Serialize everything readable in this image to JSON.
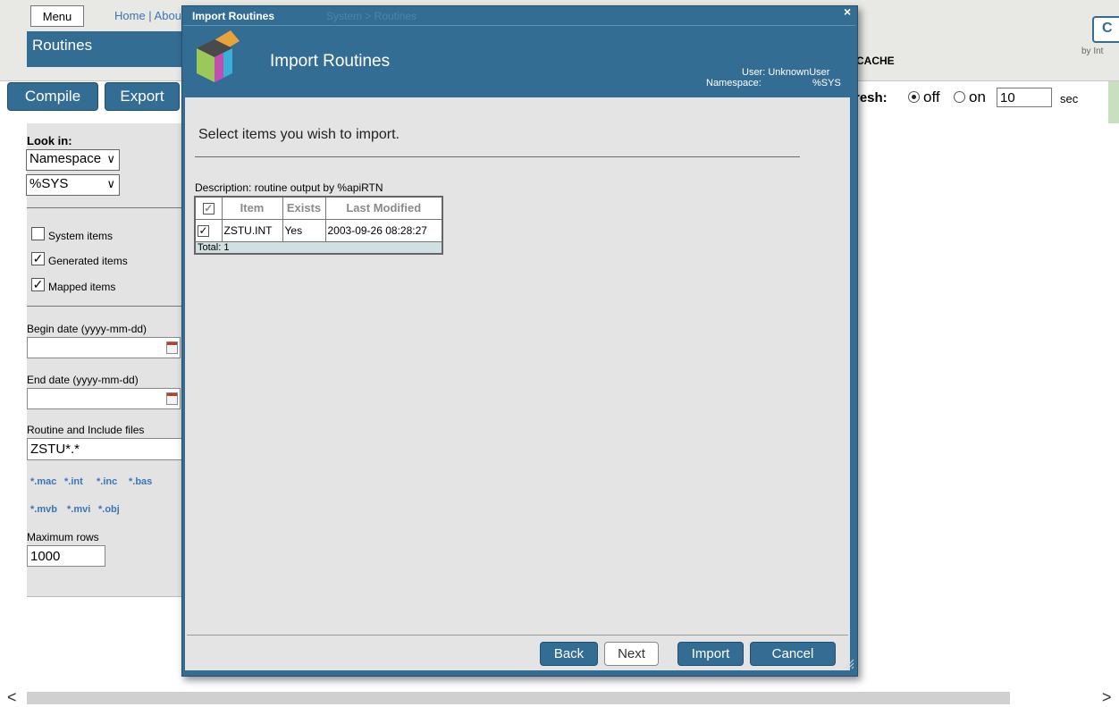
{
  "background": {
    "menu_label": "Menu",
    "top_links": "Home | About",
    "page_title": "Routines",
    "cache_text": "CACHE",
    "c_button": "C",
    "by_text": "by Int",
    "toolbar": {
      "compile": "Compile",
      "export": "Export"
    },
    "refresh": {
      "label": "resh:",
      "off": "off",
      "on": "on",
      "value": "10",
      "unit": "sec"
    },
    "left_panel": {
      "look_in_label": "Look in:",
      "look_in_value": "Namespace",
      "namespace_value": "%SYS",
      "system_items": "System items",
      "generated_items": "Generated items",
      "mapped_items": "Mapped items",
      "begin_date_label": "Begin date (yyyy-mm-dd)",
      "end_date_label": "End date (yyyy-mm-dd)",
      "routine_label": "Routine and Include files",
      "routine_value": "ZSTU*.*",
      "extensions": [
        "*.mac",
        "*.int",
        "*.inc",
        "*.bas",
        "*.mvb",
        "*.mvi",
        "*.obj"
      ],
      "max_rows_label": "Maximum rows",
      "max_rows_value": "1000"
    },
    "scroll": {
      "left": "<",
      "right": ">"
    }
  },
  "dialog": {
    "titlebar": "Import Routines",
    "titlebar_ghost": "System > Routines",
    "close": "×",
    "heading": "Import Routines",
    "user": "User: UnknownUser",
    "namespace_label": "Namespace:",
    "namespace_value": "%SYS",
    "instruction": "Select items you wish to import.",
    "description": "Description: routine output by %apiRTN",
    "table": {
      "headers": {
        "item": "Item",
        "exists": "Exists",
        "modified": "Last Modified"
      },
      "rows": [
        {
          "item": "ZSTU.INT",
          "exists": "Yes",
          "modified": "2003-09-26 08:28:27"
        }
      ],
      "total": "Total: 1"
    },
    "buttons": {
      "back": "Back",
      "next": "Next",
      "import": "Import",
      "cancel": "Cancel"
    }
  },
  "colors": {
    "accent": "#346d94",
    "panel": "#e4e4e4",
    "link": "#3a76b6"
  }
}
